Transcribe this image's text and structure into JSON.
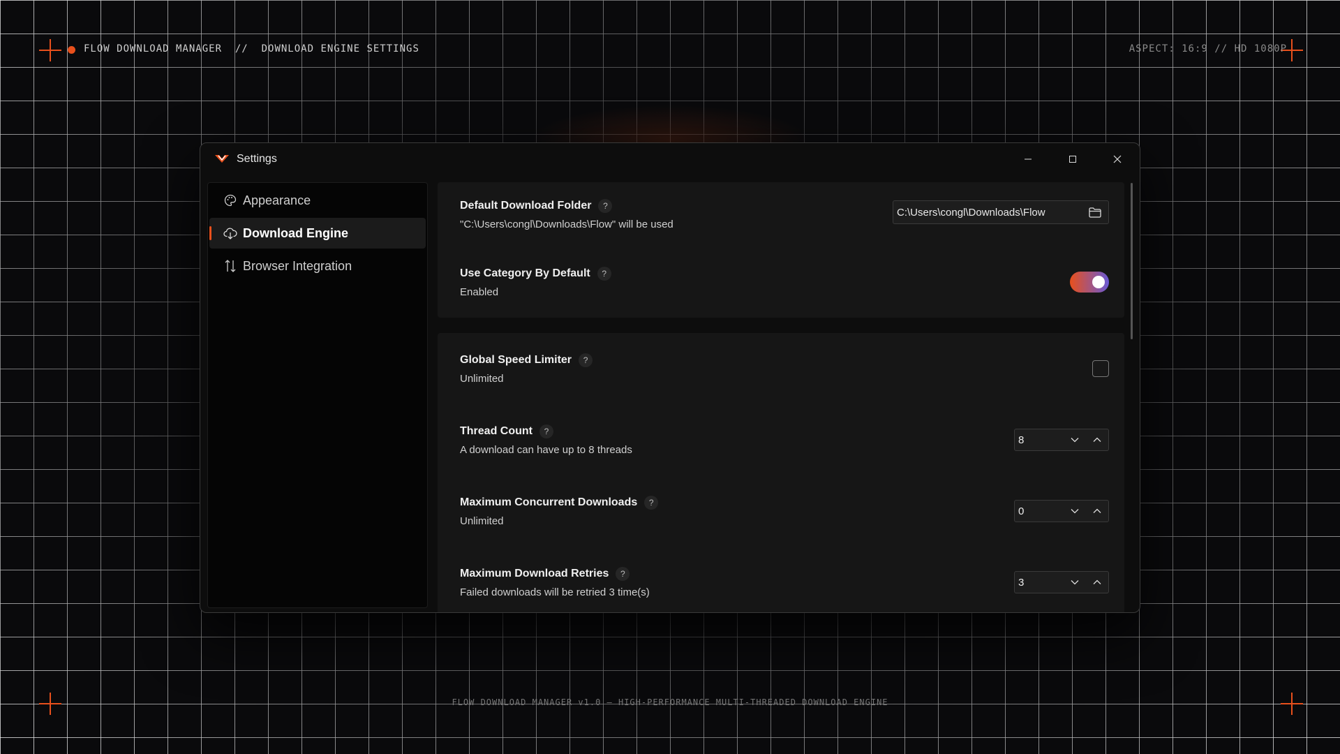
{
  "hud": {
    "brand": "FLOW DOWNLOAD MANAGER",
    "separator": "//",
    "page": "DOWNLOAD ENGINE SETTINGS",
    "aspect": "ASPECT: 16:9 // HD 1080P",
    "footer": "FLOW DOWNLOAD MANAGER v1.0 — HIGH-PERFORMANCE MULTI-THREADED DOWNLOAD ENGINE"
  },
  "colors": {
    "accent": "#e8501c",
    "toggle_end": "#6a5ad6"
  },
  "window": {
    "title": "Settings",
    "controls": [
      "minimize-icon",
      "maximize-icon",
      "close-icon"
    ]
  },
  "sidebar": {
    "items": [
      {
        "label": "Appearance",
        "icon": "palette-icon",
        "active": false
      },
      {
        "label": "Download Engine",
        "icon": "cloud-download-icon",
        "active": true
      },
      {
        "label": "Browser Integration",
        "icon": "arrows-up-down-icon",
        "active": false
      }
    ]
  },
  "settings": {
    "download_folder": {
      "title": "Default Download Folder",
      "subtitle": "\"C:\\Users\\congl\\Downloads\\Flow\" will be used",
      "value": "C:\\Users\\congl\\Downloads\\Flow",
      "icon": "folder-icon"
    },
    "use_category": {
      "title": "Use Category By Default",
      "subtitle": "Enabled",
      "enabled": true
    },
    "speed_limiter": {
      "title": "Global Speed Limiter",
      "subtitle": "Unlimited",
      "checked": false
    },
    "thread_count": {
      "title": "Thread Count",
      "subtitle": "A download can have up to 8 threads",
      "value": "8"
    },
    "max_concurrent": {
      "title": "Maximum Concurrent Downloads",
      "subtitle": "Unlimited",
      "value": "0"
    },
    "max_retries": {
      "title": "Maximum Download Retries",
      "subtitle": "Failed downloads will be retried 3 time(s)",
      "value": "3"
    },
    "help_symbol": "?"
  }
}
